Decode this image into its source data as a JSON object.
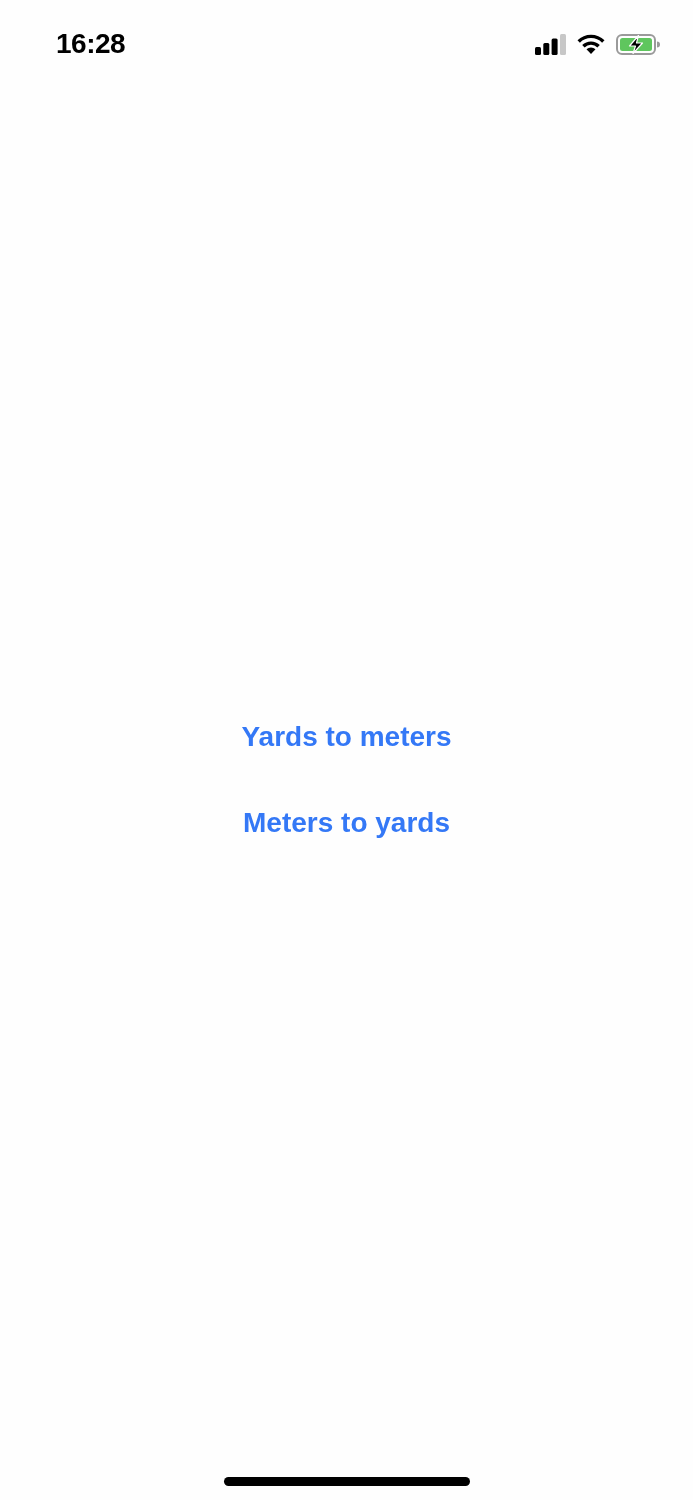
{
  "status_bar": {
    "time": "16:28"
  },
  "buttons": [
    {
      "label": "Yards to meters"
    },
    {
      "label": "Meters to yards"
    }
  ]
}
